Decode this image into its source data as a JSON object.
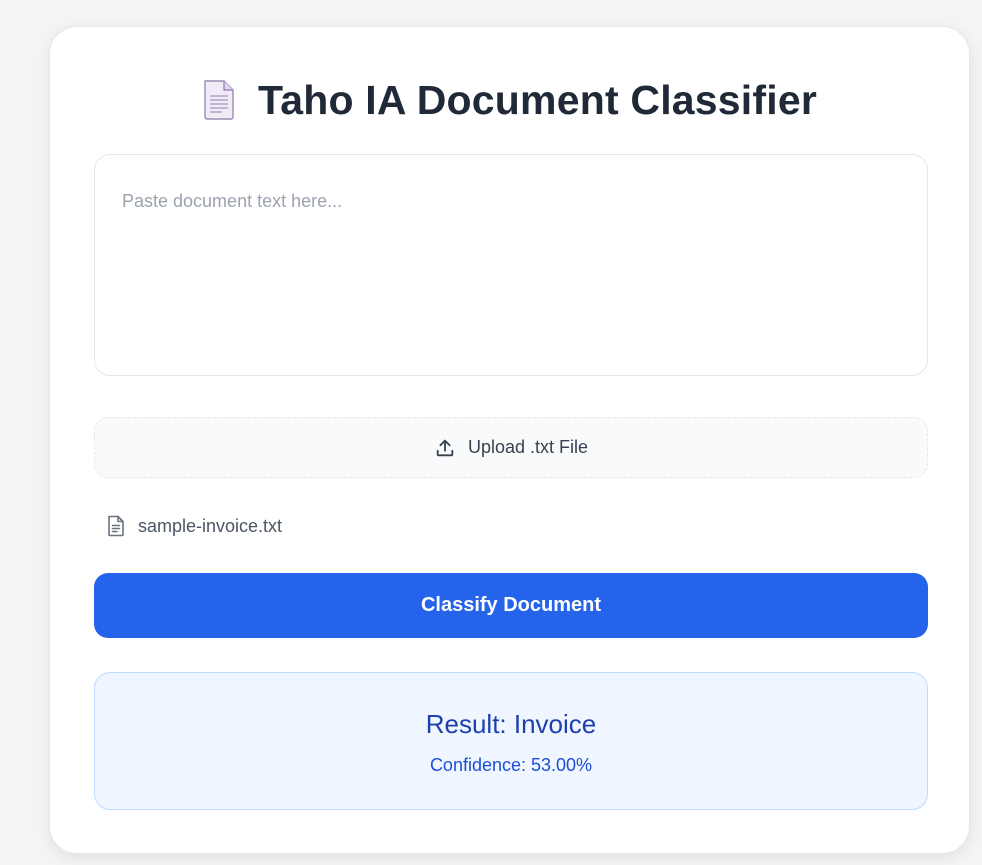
{
  "header": {
    "title": "Taho IA Document Classifier",
    "icon": "page-facing-up-emoji"
  },
  "text_input": {
    "value": "",
    "placeholder": "Paste document text here..."
  },
  "upload": {
    "label": "Upload .txt File",
    "icon": "upload-icon"
  },
  "selected_file": {
    "name": "sample-invoice.txt",
    "icon": "file-text-icon"
  },
  "classify_button": {
    "label": "Classify Document"
  },
  "result": {
    "title": "Result: Invoice",
    "confidence": "Confidence: 53.00%"
  },
  "colors": {
    "background": "#f3f4f6",
    "card": "#ffffff",
    "primary": "#2563eb",
    "result_bg": "#eff6ff",
    "result_text": "#1e40af",
    "title_text": "#1f2937"
  }
}
